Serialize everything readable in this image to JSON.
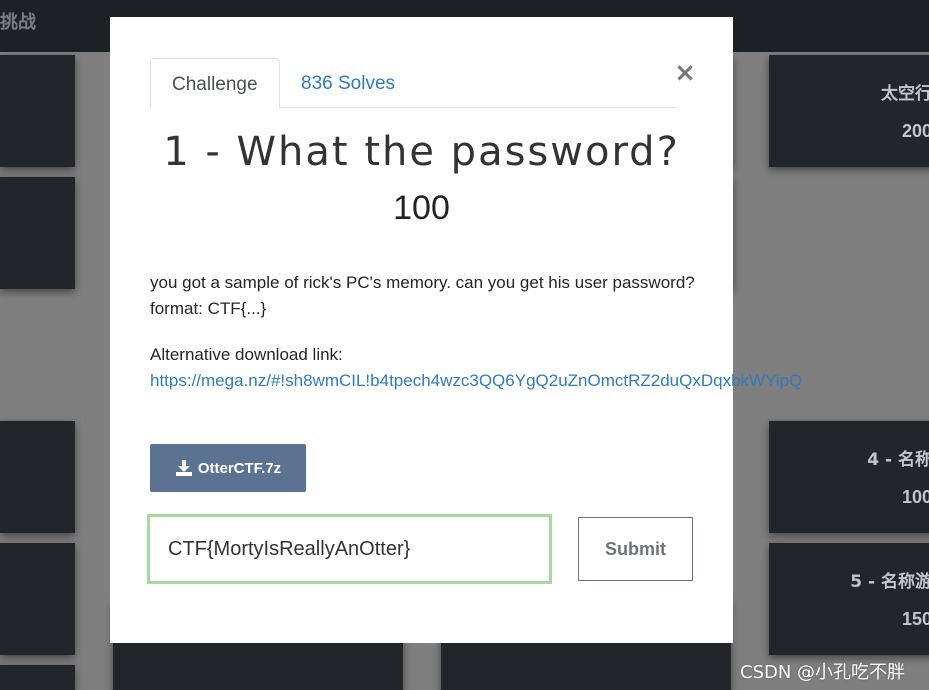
{
  "background": {
    "nav_title": "挑战",
    "cards": [
      {
        "title": "太空行",
        "value": "200"
      },
      {
        "title": "4 - 名称",
        "value": "100"
      },
      {
        "title": "5 - 名称游",
        "value": "150"
      }
    ]
  },
  "modal": {
    "tabs": [
      {
        "label": "Challenge",
        "active": true
      },
      {
        "label": "836 Solves",
        "active": false
      }
    ],
    "close_label": "×",
    "title": "1 - What the password?",
    "value": "100",
    "description_line1": "you got a sample of rick's PC's memory. can you get his user password?",
    "description_line2": "format: CTF{...}",
    "alt_download_label": "Alternative download link:",
    "alt_download_url": "https://mega.nz/#!sh8wmCIL!b4tpech4wzc3QQ6YgQ2uZnOmctRZ2duQxDqxbkWYipQ",
    "file_button_label": "OtterCTF.7z",
    "file_icon": "download-icon",
    "flag_input_value": "CTF{MortyIsReallyAnOtter}",
    "submit_label": "Submit"
  },
  "watermark": "CSDN @小孔吃不胖",
  "colors": {
    "accent_link": "#337ab7",
    "file_button": "#5b7290",
    "input_border": "#a6d8a0",
    "overlay": "#7f7f7f",
    "card_bg": "#22262a"
  }
}
